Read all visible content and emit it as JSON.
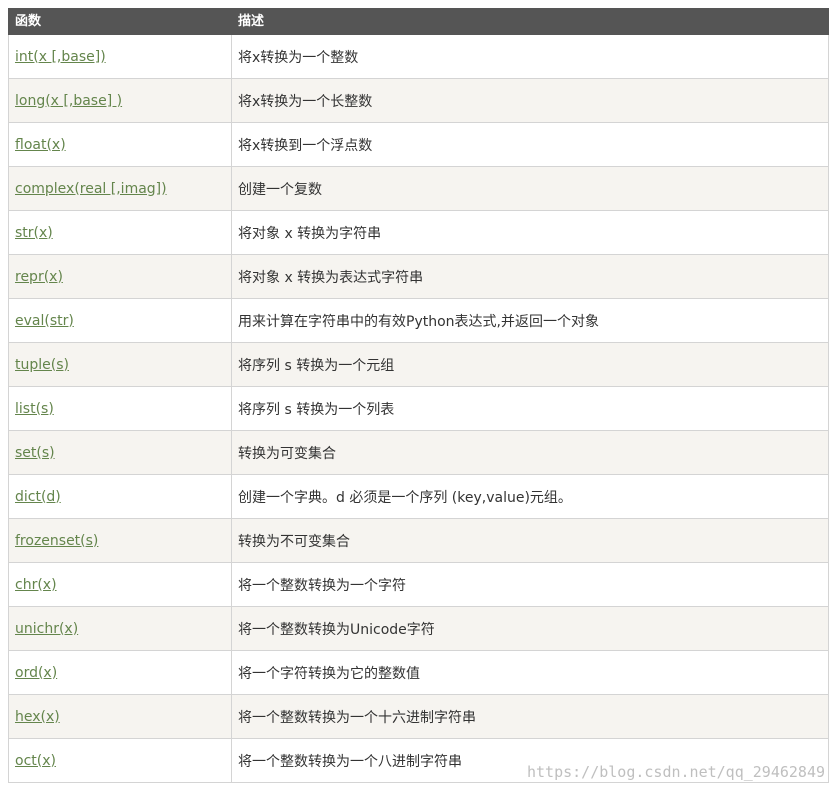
{
  "header": {
    "col_function": "函数",
    "col_description": "描述"
  },
  "rows": [
    {
      "function": "int(x [,base])",
      "description": "将x转换为一个整数"
    },
    {
      "function": "long(x [,base] )",
      "description": "将x转换为一个长整数"
    },
    {
      "function": "float(x)",
      "description": "将x转换到一个浮点数"
    },
    {
      "function": "complex(real [,imag])",
      "description": "创建一个复数"
    },
    {
      "function": "str(x)",
      "description": "将对象 x 转换为字符串"
    },
    {
      "function": "repr(x)",
      "description": "将对象 x 转换为表达式字符串"
    },
    {
      "function": "eval(str)",
      "description": "用来计算在字符串中的有效Python表达式,并返回一个对象"
    },
    {
      "function": "tuple(s)",
      "description": "将序列 s 转换为一个元组"
    },
    {
      "function": "list(s)",
      "description": "将序列 s 转换为一个列表"
    },
    {
      "function": "set(s)",
      "description": "转换为可变集合"
    },
    {
      "function": "dict(d)",
      "description": "创建一个字典。d 必须是一个序列 (key,value)元组。"
    },
    {
      "function": "frozenset(s)",
      "description": "转换为不可变集合"
    },
    {
      "function": "chr(x)",
      "description": "将一个整数转换为一个字符"
    },
    {
      "function": "unichr(x)",
      "description": "将一个整数转换为Unicode字符"
    },
    {
      "function": "ord(x)",
      "description": "将一个字符转换为它的整数值"
    },
    {
      "function": "hex(x)",
      "description": "将一个整数转换为一个十六进制字符串"
    },
    {
      "function": "oct(x)",
      "description": "将一个整数转换为一个八进制字符串"
    }
  ],
  "watermark": "https://blog.csdn.net/qq_29462849",
  "colors": {
    "header_bg": "#555555",
    "link": "#64854c",
    "row_alt_bg": "#f6f4f0",
    "border": "#d4d4d4"
  }
}
